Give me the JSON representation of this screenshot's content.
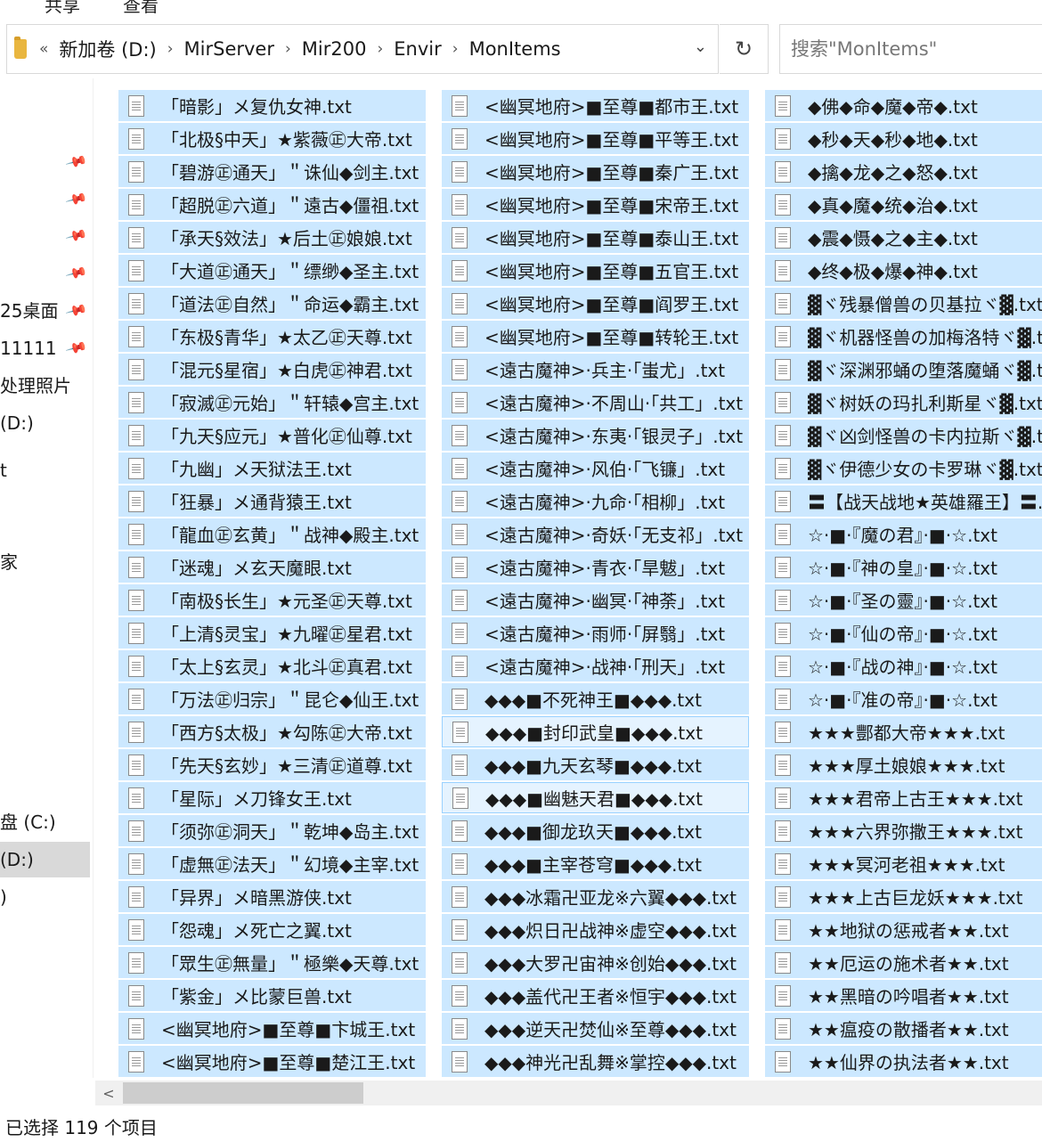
{
  "ribbon": {
    "tabs": [
      "共享",
      "查看"
    ]
  },
  "address_bar": {
    "overflow": "«",
    "breadcrumbs": [
      "新加卷 (D:)",
      "MirServer",
      "Mir200",
      "Envir",
      "MonItems"
    ],
    "separator": "›"
  },
  "search": {
    "placeholder": "搜索\"MonItems\""
  },
  "nav": {
    "items": [
      "25桌面",
      "11111",
      "处理照片",
      "(D:)",
      "t",
      "",
      "家",
      "",
      "",
      "盘 (C:)",
      "(D:)",
      ")"
    ],
    "selected_index": 10
  },
  "columns": [
    [
      "「暗影」メ复仇女神.txt",
      "「北极§中天」★紫薇㊣大帝.txt",
      "「碧游㊣通天」＂诛仙◆剑主.txt",
      "「超脱㊣六道」＂遠古◆僵祖.txt",
      "「承天§效法」★后土㊣娘娘.txt",
      "「大道㊣通天」＂缥缈◆圣主.txt",
      "「道法㊣自然」＂命运◆霸主.txt",
      "「东极§青华」★太乙㊣天尊.txt",
      "「混元§星宿」★白虎㊣神君.txt",
      "「寂滅㊣元始」＂轩辕◆宫主.txt",
      "「九天§应元」★普化㊣仙尊.txt",
      "「九幽」メ天狱法王.txt",
      "「狂暴」メ通背猿王.txt",
      "「龍血㊣玄黄」＂战神◆殿主.txt",
      "「迷魂」メ玄天魔眼.txt",
      "「南极§长生」★元圣㊣天尊.txt",
      "「上清§灵宝」★九曜㊣星君.txt",
      "「太上§玄灵」★北斗㊣真君.txt",
      "「万法㊣归宗」＂昆仑◆仙王.txt",
      "「西方§太极」★勾陈㊣大帝.txt",
      "「先天§玄妙」★三清㊣道尊.txt",
      "「星际」メ刀锋女王.txt",
      "「须弥㊣洞天」＂乾坤◆岛主.txt",
      "「虚無㊣法天」＂幻境◆主宰.txt",
      "「异界」メ暗黑游侠.txt",
      "「怨魂」メ死亡之翼.txt",
      "「眾生㊣無量」＂極樂◆天尊.txt",
      "「紫金」メ比蒙巨兽.txt",
      "<幽冥地府>■至尊■卞城王.txt",
      "<幽冥地府>■至尊■楚江王.txt"
    ],
    [
      "<幽冥地府>■至尊■都市王.txt",
      "<幽冥地府>■至尊■平等王.txt",
      "<幽冥地府>■至尊■秦广王.txt",
      "<幽冥地府>■至尊■宋帝王.txt",
      "<幽冥地府>■至尊■泰山王.txt",
      "<幽冥地府>■至尊■五官王.txt",
      "<幽冥地府>■至尊■阎罗王.txt",
      "<幽冥地府>■至尊■转轮王.txt",
      "<遠古魔神>·兵主·「蚩尤」.txt",
      "<遠古魔神>·不周山·「共工」.txt",
      "<遠古魔神>·东夷·「银灵子」.txt",
      "<遠古魔神>·风伯·「飞镰」.txt",
      "<遠古魔神>·九命·「相柳」.txt",
      "<遠古魔神>·奇妖·「无支祁」.txt",
      "<遠古魔神>·青衣·「旱魃」.txt",
      "<遠古魔神>·幽冥·「神荼」.txt",
      "<遠古魔神>·雨师·「屏翳」.txt",
      "<遠古魔神>·战神·「刑天」.txt",
      "◆◆◆■不死神王■◆◆◆.txt",
      "◆◆◆■封印武皇■◆◆◆.txt",
      "◆◆◆■九天玄琴■◆◆◆.txt",
      "◆◆◆■幽魅天君■◆◆◆.txt",
      "◆◆◆■御龙玖天■◆◆◆.txt",
      "◆◆◆■主宰苍穹■◆◆◆.txt",
      "◆◆◆冰霜卍亚龙※六翼◆◆◆.txt",
      "◆◆◆炽日卍战神※虚空◆◆◆.txt",
      "◆◆◆大罗卍宙神※创始◆◆◆.txt",
      "◆◆◆盖代卍王者※恒宇◆◆◆.txt",
      "◆◆◆逆天卍焚仙※至尊◆◆◆.txt",
      "◆◆◆神光卍乱舞※掌控◆◆◆.txt"
    ],
    [
      "◆佛◆命◆魔◆帝◆.txt",
      "◆秒◆天◆秒◆地◆.txt",
      "◆擒◆龙◆之◆怒◆.txt",
      "◆真◆魔◆统◆治◆.txt",
      "◆震◆慑◆之◆主◆.txt",
      "◆终◆极◆爆◆神◆.txt",
      "▓ヾ残暴僧兽の贝基拉ヾ▓.txt",
      "▓ヾ机器怪兽の加梅洛特ヾ▓.txt",
      "▓ヾ深渊邪蛹の堕落魔蛹ヾ▓.txt",
      "▓ヾ树妖の玛扎利斯星ヾ▓.txt",
      "▓ヾ凶剑怪兽の卡内拉斯ヾ▓.txt",
      "▓ヾ伊德少女の卡罗琳ヾ▓.txt",
      "〓【战天战地★英雄羅王】〓.txt",
      "☆·■·『魔の君』·■·☆.txt",
      "☆·■·『神の皇』·■·☆.txt",
      "☆·■·『圣の靈』·■·☆.txt",
      "☆·■·『仙の帝』·■·☆.txt",
      "☆·■·『战の神』·■·☆.txt",
      "☆·■·『准の帝』·■·☆.txt",
      "★★★酆都大帝★★★.txt",
      "★★★厚土娘娘★★★.txt",
      "★★★君帝上古王★★★.txt",
      "★★★六界弥撒王★★★.txt",
      "★★★冥河老祖★★★.txt",
      "★★★上古巨龙妖★★★.txt",
      "★★地狱の惩戒者★★.txt",
      "★★厄运の施术者★★.txt",
      "★★黑暗の吟唱者★★.txt",
      "★★瘟疫の散播者★★.txt",
      "★★仙界の执法者★★.txt"
    ]
  ],
  "focused_files": [
    [
      1,
      19
    ],
    [
      1,
      21
    ]
  ],
  "status": {
    "selection": "已选择 119 个项目"
  },
  "scrollbar": {
    "left_arrow": "<"
  }
}
